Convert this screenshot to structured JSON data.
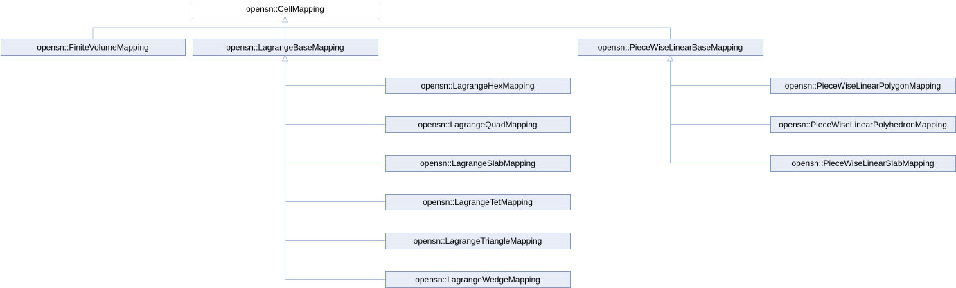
{
  "diagram": {
    "type": "class-inheritance",
    "colors": {
      "node_fill": "#e8ecf6",
      "node_border": "#8796c0",
      "root_fill": "#ffffff",
      "root_border": "#000000",
      "edge": "#a9c0dd"
    },
    "nodes": [
      {
        "id": "cell_mapping",
        "label": "opensn::CellMapping",
        "parent": null
      },
      {
        "id": "finite_volume",
        "label": "opensn::FiniteVolumeMapping",
        "parent": "cell_mapping"
      },
      {
        "id": "lagrange_base",
        "label": "opensn::LagrangeBaseMapping",
        "parent": "cell_mapping"
      },
      {
        "id": "pwl_base",
        "label": "opensn::PieceWiseLinearBaseMapping",
        "parent": "cell_mapping"
      },
      {
        "id": "lagrange_hex",
        "label": "opensn::LagrangeHexMapping",
        "parent": "lagrange_base"
      },
      {
        "id": "lagrange_quad",
        "label": "opensn::LagrangeQuadMapping",
        "parent": "lagrange_base"
      },
      {
        "id": "lagrange_slab",
        "label": "opensn::LagrangeSlabMapping",
        "parent": "lagrange_base"
      },
      {
        "id": "lagrange_tet",
        "label": "opensn::LagrangeTetMapping",
        "parent": "lagrange_base"
      },
      {
        "id": "lagrange_triangle",
        "label": "opensn::LagrangeTriangleMapping",
        "parent": "lagrange_base"
      },
      {
        "id": "lagrange_wedge",
        "label": "opensn::LagrangeWedgeMapping",
        "parent": "lagrange_base"
      },
      {
        "id": "pwl_polygon",
        "label": "opensn::PieceWiseLinearPolygonMapping",
        "parent": "pwl_base"
      },
      {
        "id": "pwl_polyhedron",
        "label": "opensn::PieceWiseLinearPolyhedronMapping",
        "parent": "pwl_base"
      },
      {
        "id": "pwl_slab",
        "label": "opensn::PieceWiseLinearSlabMapping",
        "parent": "pwl_base"
      }
    ]
  }
}
